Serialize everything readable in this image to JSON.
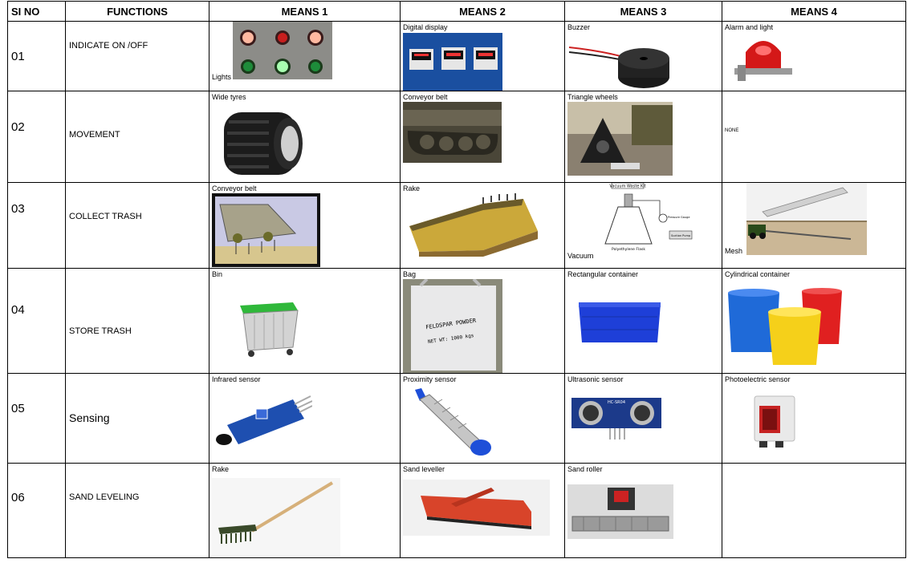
{
  "headers": {
    "sino": "SI NO",
    "functions": "FUNCTIONS",
    "m1": "MEANS 1",
    "m2": "MEANS 2",
    "m3": "MEANS 3",
    "m4": "MEANS 4"
  },
  "rows": [
    {
      "no": "01",
      "function": "INDICATE ON /OFF",
      "means": [
        "Lights",
        "Digital display",
        "Buzzer",
        "Alarm and light"
      ]
    },
    {
      "no": "02",
      "function": "MOVEMENT",
      "means": [
        "Wide tyres",
        "Conveyor belt",
        "Triangle wheels",
        "NONE"
      ]
    },
    {
      "no": "03",
      "function": "COLLECT TRASH",
      "means": [
        "Conveyor belt",
        "Rake",
        "Vacuum",
        "Mesh"
      ],
      "diagram_labels": [
        "Vacuum Waste Kit",
        "Polyethylene Flask",
        "Pressure Gauge",
        "Suction Pump"
      ]
    },
    {
      "no": "04",
      "function": "STORE TRASH",
      "means": [
        "Bin",
        "Bag",
        "Rectangular container",
        "Cylindrical container"
      ],
      "bag_print": [
        "FELDSPAR POWDER",
        "NET WT: 1000 kgs"
      ]
    },
    {
      "no": "05",
      "function": "Sensing",
      "means": [
        "Infrared sensor",
        "Proximity sensor",
        "Ultrasonic sensor",
        "Photoelectric sensor"
      ],
      "sensor_print": "HC-SR04"
    },
    {
      "no": "06",
      "function": "SAND LEVELING",
      "means": [
        "Rake",
        "Sand leveller",
        "Sand roller",
        ""
      ]
    }
  ]
}
